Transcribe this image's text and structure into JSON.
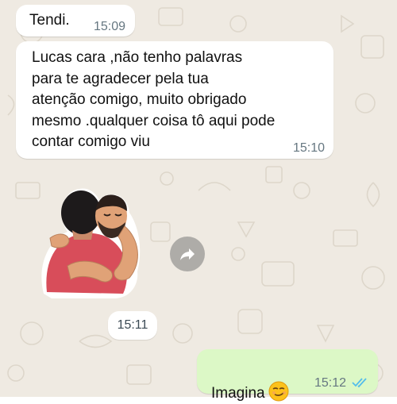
{
  "chat": {
    "colors": {
      "background": "#efeae2",
      "incoming_bubble": "#ffffff",
      "outgoing_bubble": "#dcf8c6",
      "timestamp": "#667781",
      "read_ticks": "#53bdeb"
    },
    "messages": [
      {
        "direction": "incoming",
        "text": "Tendi.",
        "time": "15:09"
      },
      {
        "direction": "incoming",
        "text": "Lucas cara ,não tenho palavras\npara te agradecer pela tua\natenção comigo, muito obrigado\nmesmo .qualquer coisa tô  aqui  pode\ncontar comigo viu",
        "time": "15:10"
      },
      {
        "direction": "incoming",
        "type": "sticker",
        "sticker": "hug-sticker",
        "time": "15:11"
      },
      {
        "direction": "outgoing",
        "text": "Imagina",
        "emoji": "smirking-face-emoji",
        "time": "15:12",
        "status": "read"
      }
    ],
    "forward_icon": "forward-icon"
  }
}
